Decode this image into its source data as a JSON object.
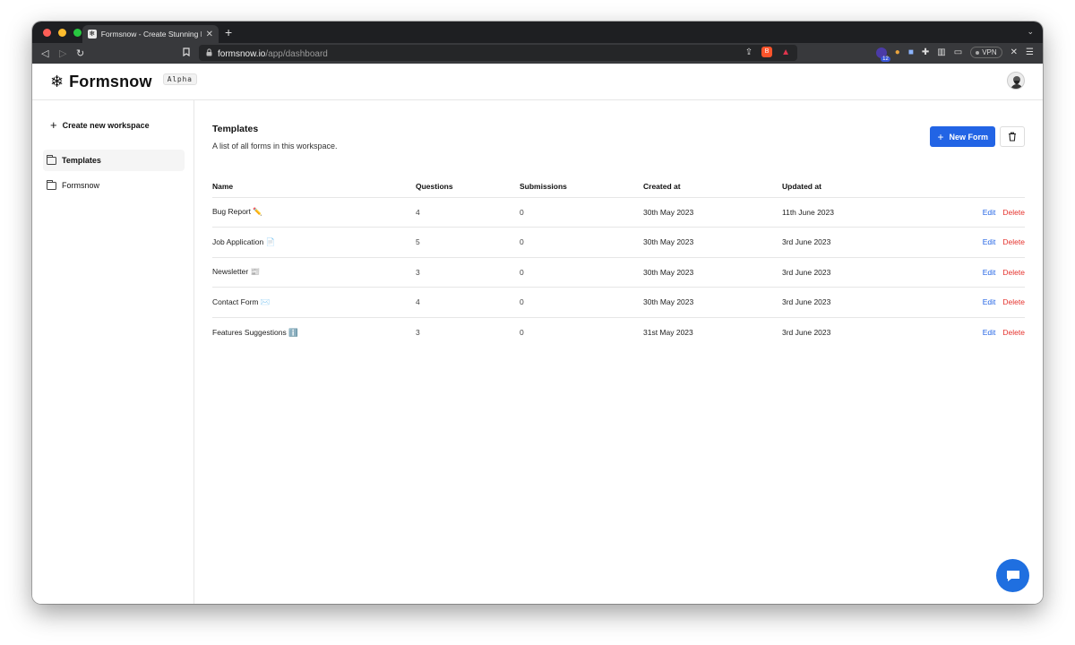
{
  "browser": {
    "tab_title": "Formsnow - Create Stunning Fo",
    "tab_favicon": "❄",
    "url_host": "formsnow.io",
    "url_path": "/app/dashboard",
    "ext_badge": "12",
    "vpn_label": "VPN"
  },
  "app": {
    "logo_text": "Formsnow",
    "logo_icon": "❄",
    "badge": "Alpha"
  },
  "sidebar": {
    "create_label": "Create new workspace",
    "items": [
      {
        "label": "Templates",
        "active": true
      },
      {
        "label": "Formsnow",
        "active": false
      }
    ]
  },
  "main": {
    "title": "Templates",
    "subtitle": "A list of all forms in this workspace.",
    "new_form_label": "New Form"
  },
  "table": {
    "columns": [
      "Name",
      "Questions",
      "Submissions",
      "Created at",
      "Updated at"
    ],
    "edit_label": "Edit",
    "delete_label": "Delete",
    "rows": [
      {
        "name": "Bug Report ✏️",
        "questions": "4",
        "submissions": "0",
        "created": "30th May 2023",
        "updated": "11th June 2023"
      },
      {
        "name": "Job Application 📄",
        "questions": "5",
        "submissions": "0",
        "created": "30th May 2023",
        "updated": "3rd June 2023"
      },
      {
        "name": "Newsletter 📰",
        "questions": "3",
        "submissions": "0",
        "created": "30th May 2023",
        "updated": "3rd June 2023"
      },
      {
        "name": "Contact Form ✉️",
        "questions": "4",
        "submissions": "0",
        "created": "30th May 2023",
        "updated": "3rd June 2023"
      },
      {
        "name": "Features Suggestions ℹ️",
        "questions": "3",
        "submissions": "0",
        "created": "31st May 2023",
        "updated": "3rd June 2023"
      }
    ]
  },
  "colors": {
    "primary": "#2264e5",
    "danger": "#e5322d",
    "chat": "#1f6fe0"
  }
}
